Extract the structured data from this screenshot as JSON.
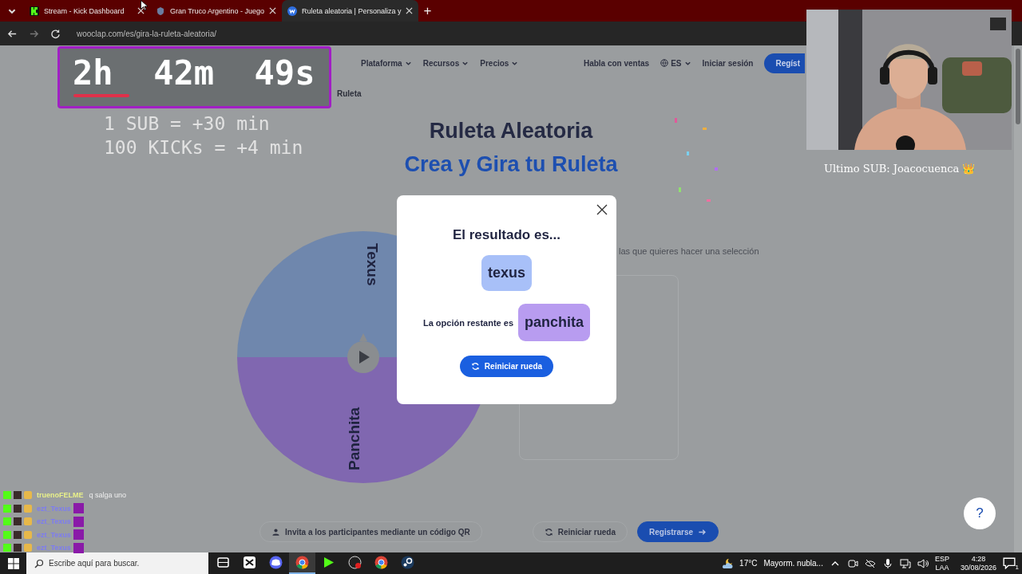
{
  "browser": {
    "tabs": [
      {
        "title": "Stream - Kick Dashboard",
        "selected": false,
        "kind": "kick"
      },
      {
        "title": "Gran Truco Argentino - Juego",
        "selected": false,
        "kind": "cards"
      },
      {
        "title": "Ruleta aleatoria | Personaliza y",
        "selected": true,
        "kind": "wooclap"
      }
    ],
    "new_tab": "+",
    "address_bar": {
      "url": "wooclap.com/es/gira-la-ruleta-aleatoria/"
    }
  },
  "page": {
    "nav": [
      {
        "label": "Plataforma",
        "kind": "menu"
      },
      {
        "label": "Recursos",
        "kind": "menu"
      },
      {
        "label": "Precios",
        "kind": "menu"
      }
    ],
    "nav_right": [
      {
        "label": "Habla con ventas",
        "kind": "link"
      },
      {
        "label": "ES",
        "kind": "language"
      },
      {
        "label": "Iniciar sesión",
        "kind": "link"
      },
      {
        "label": "Regíst",
        "kind": "button"
      }
    ],
    "breadcrumb": "Ruleta",
    "title": "Ruleta Aleatoria",
    "subtitle": "Crea y Gira tu Ruleta",
    "wheel": {
      "segments": [
        {
          "label": "Texus",
          "color": "#6f87ad"
        },
        {
          "label": "Panchita",
          "color": "#8067b0"
        }
      ]
    },
    "hint": "las que quieres hacer una selección",
    "buttons": [
      {
        "label": "Invita a los participantes mediante un código QR",
        "kind": "qr"
      },
      {
        "label": "Reiniciar rueda",
        "kind": "reset"
      },
      {
        "label": "Registrarse",
        "kind": "primary"
      }
    ],
    "help": "?"
  },
  "modal": {
    "heading": "El resultado es...",
    "result": "texus",
    "remaining_label": "La opción restante es",
    "remaining": "panchita",
    "button": "Reiniciar rueda"
  },
  "overlay": {
    "timer": "2h  42m  49s",
    "rules": [
      "1 SUB = +30 min",
      "100 KICKs = +4 min"
    ],
    "last_sub": "Ultimo SUB: Joacocuenca 👑",
    "chat": [
      {
        "user": "truenoFELME",
        "message": "q salga uno",
        "color": "#e8f08a"
      },
      {
        "user": "ezt_Texus",
        "color": "#7d7cf0"
      },
      {
        "user": "ezt_Texus",
        "color": "#7d7cf0"
      },
      {
        "user": "ezt_Texus",
        "color": "#7d7cf0"
      },
      {
        "user": "ezt_Texus",
        "color": "#7d7cf0"
      }
    ]
  },
  "taskbar": {
    "search_placeholder": "Escribe aquí para buscar.",
    "apps": [
      {
        "kind": "editor",
        "selected": false
      },
      {
        "kind": "chat",
        "selected": false
      },
      {
        "kind": "browser",
        "selected": true
      },
      {
        "kind": "media",
        "selected": false
      },
      {
        "kind": "recorder",
        "selected": false
      },
      {
        "kind": "browser",
        "selected": false
      },
      {
        "kind": "store",
        "selected": false
      }
    ],
    "weather": {
      "temp": "17°C",
      "desc": "Mayorm. nubla..."
    },
    "lang": [
      "ESP",
      "LAA"
    ],
    "time": "4:28",
    "date": "30/08/2026",
    "notifications": "1"
  }
}
